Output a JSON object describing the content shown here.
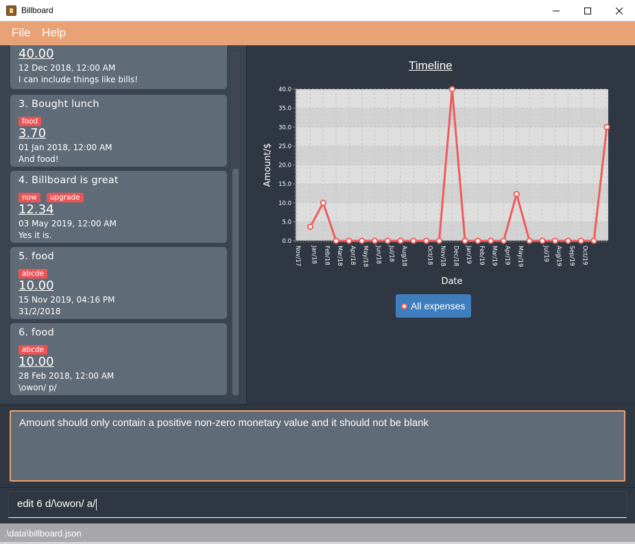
{
  "window": {
    "title": "Billboard"
  },
  "menu": {
    "items": [
      "File",
      "Help"
    ]
  },
  "expenses": [
    {
      "title": "",
      "tags": [],
      "amount": "40.00",
      "date": "12 Dec 2018, 12:00 AM",
      "desc": "I can include things like bills!"
    },
    {
      "title": "3.  Bought lunch",
      "tags": [
        "food"
      ],
      "amount": "3.70",
      "date": "01 Jan 2018, 12:00 AM",
      "desc": "And food!"
    },
    {
      "title": "4.  Billboard is great",
      "tags": [
        "now",
        "upgrade"
      ],
      "amount": "12.34",
      "date": "03 May 2019, 12:00 AM",
      "desc": "Yes it is."
    },
    {
      "title": "5.  food",
      "tags": [
        "abcde"
      ],
      "amount": "10.00",
      "date": "15 Nov 2019, 04:16 PM",
      "desc": "31/2/2018"
    },
    {
      "title": "6.  food",
      "tags": [
        "abcde"
      ],
      "amount": "10.00",
      "date": "28 Feb 2018, 12:00 AM",
      "desc": "\\owon/ p/"
    }
  ],
  "chart_data": {
    "type": "line",
    "title": "Timeline",
    "xlabel": "Date",
    "ylabel": "Amount/$",
    "ylim": [
      0,
      40
    ],
    "y_ticks": [
      "0.0",
      "5.0",
      "10.0",
      "15.0",
      "20.0",
      "25.0",
      "30.0",
      "35.0",
      "40.0"
    ],
    "x_tick_labels": [
      "Nov/17",
      "Jan/18",
      "Feb/18",
      "Mar/18",
      "Apr/18",
      "May/18",
      "Jun/18",
      "Jul/18",
      "Aug/18",
      "Oct/18",
      "Nov/18",
      "Dec/18",
      "Jan/19",
      "Feb/19",
      "Mar/19",
      "Apr/19",
      "May/19",
      "Jul/19",
      "Aug/19",
      "Sep/19",
      "Oct/19"
    ],
    "series": [
      {
        "name": "All expenses",
        "color": "#ef5b5b",
        "points": [
          {
            "x": "Jan/18",
            "y": 3.7
          },
          {
            "x": "Feb/18",
            "y": 10.0
          },
          {
            "x": "Mar/18",
            "y": 0
          },
          {
            "x": "Apr/18",
            "y": 0
          },
          {
            "x": "May/18",
            "y": 0
          },
          {
            "x": "Jun/18",
            "y": 0
          },
          {
            "x": "Jul/18",
            "y": 0
          },
          {
            "x": "Aug/18",
            "y": 0
          },
          {
            "x": "Sep/18",
            "y": 0
          },
          {
            "x": "Oct/18",
            "y": 0
          },
          {
            "x": "Nov/18",
            "y": 0
          },
          {
            "x": "Dec/18",
            "y": 40.0
          },
          {
            "x": "Jan/19",
            "y": 0
          },
          {
            "x": "Feb/19",
            "y": 0
          },
          {
            "x": "Mar/19",
            "y": 0
          },
          {
            "x": "Apr/19",
            "y": 0
          },
          {
            "x": "May/19",
            "y": 12.34
          },
          {
            "x": "Jun/19",
            "y": 0
          },
          {
            "x": "Jul/19",
            "y": 0
          },
          {
            "x": "Aug/19",
            "y": 0
          },
          {
            "x": "Sep/19",
            "y": 0
          },
          {
            "x": "Oct/19",
            "y": 0
          },
          {
            "x": "Nov/19",
            "y": 0
          },
          {
            "x": "Dec/19",
            "y": 30.0
          }
        ]
      }
    ]
  },
  "legend": {
    "label": "All expenses"
  },
  "result": {
    "text": "Amount should only contain a positive non-zero monetary value and it should not be blank"
  },
  "command": {
    "value": "edit 6 d/\\owon/ a/"
  },
  "status": {
    "path": ".\\data\\billboard.json"
  },
  "colors": {
    "accent": "#e8a275",
    "tag": "#ea5455",
    "series": "#ef5b5b"
  }
}
